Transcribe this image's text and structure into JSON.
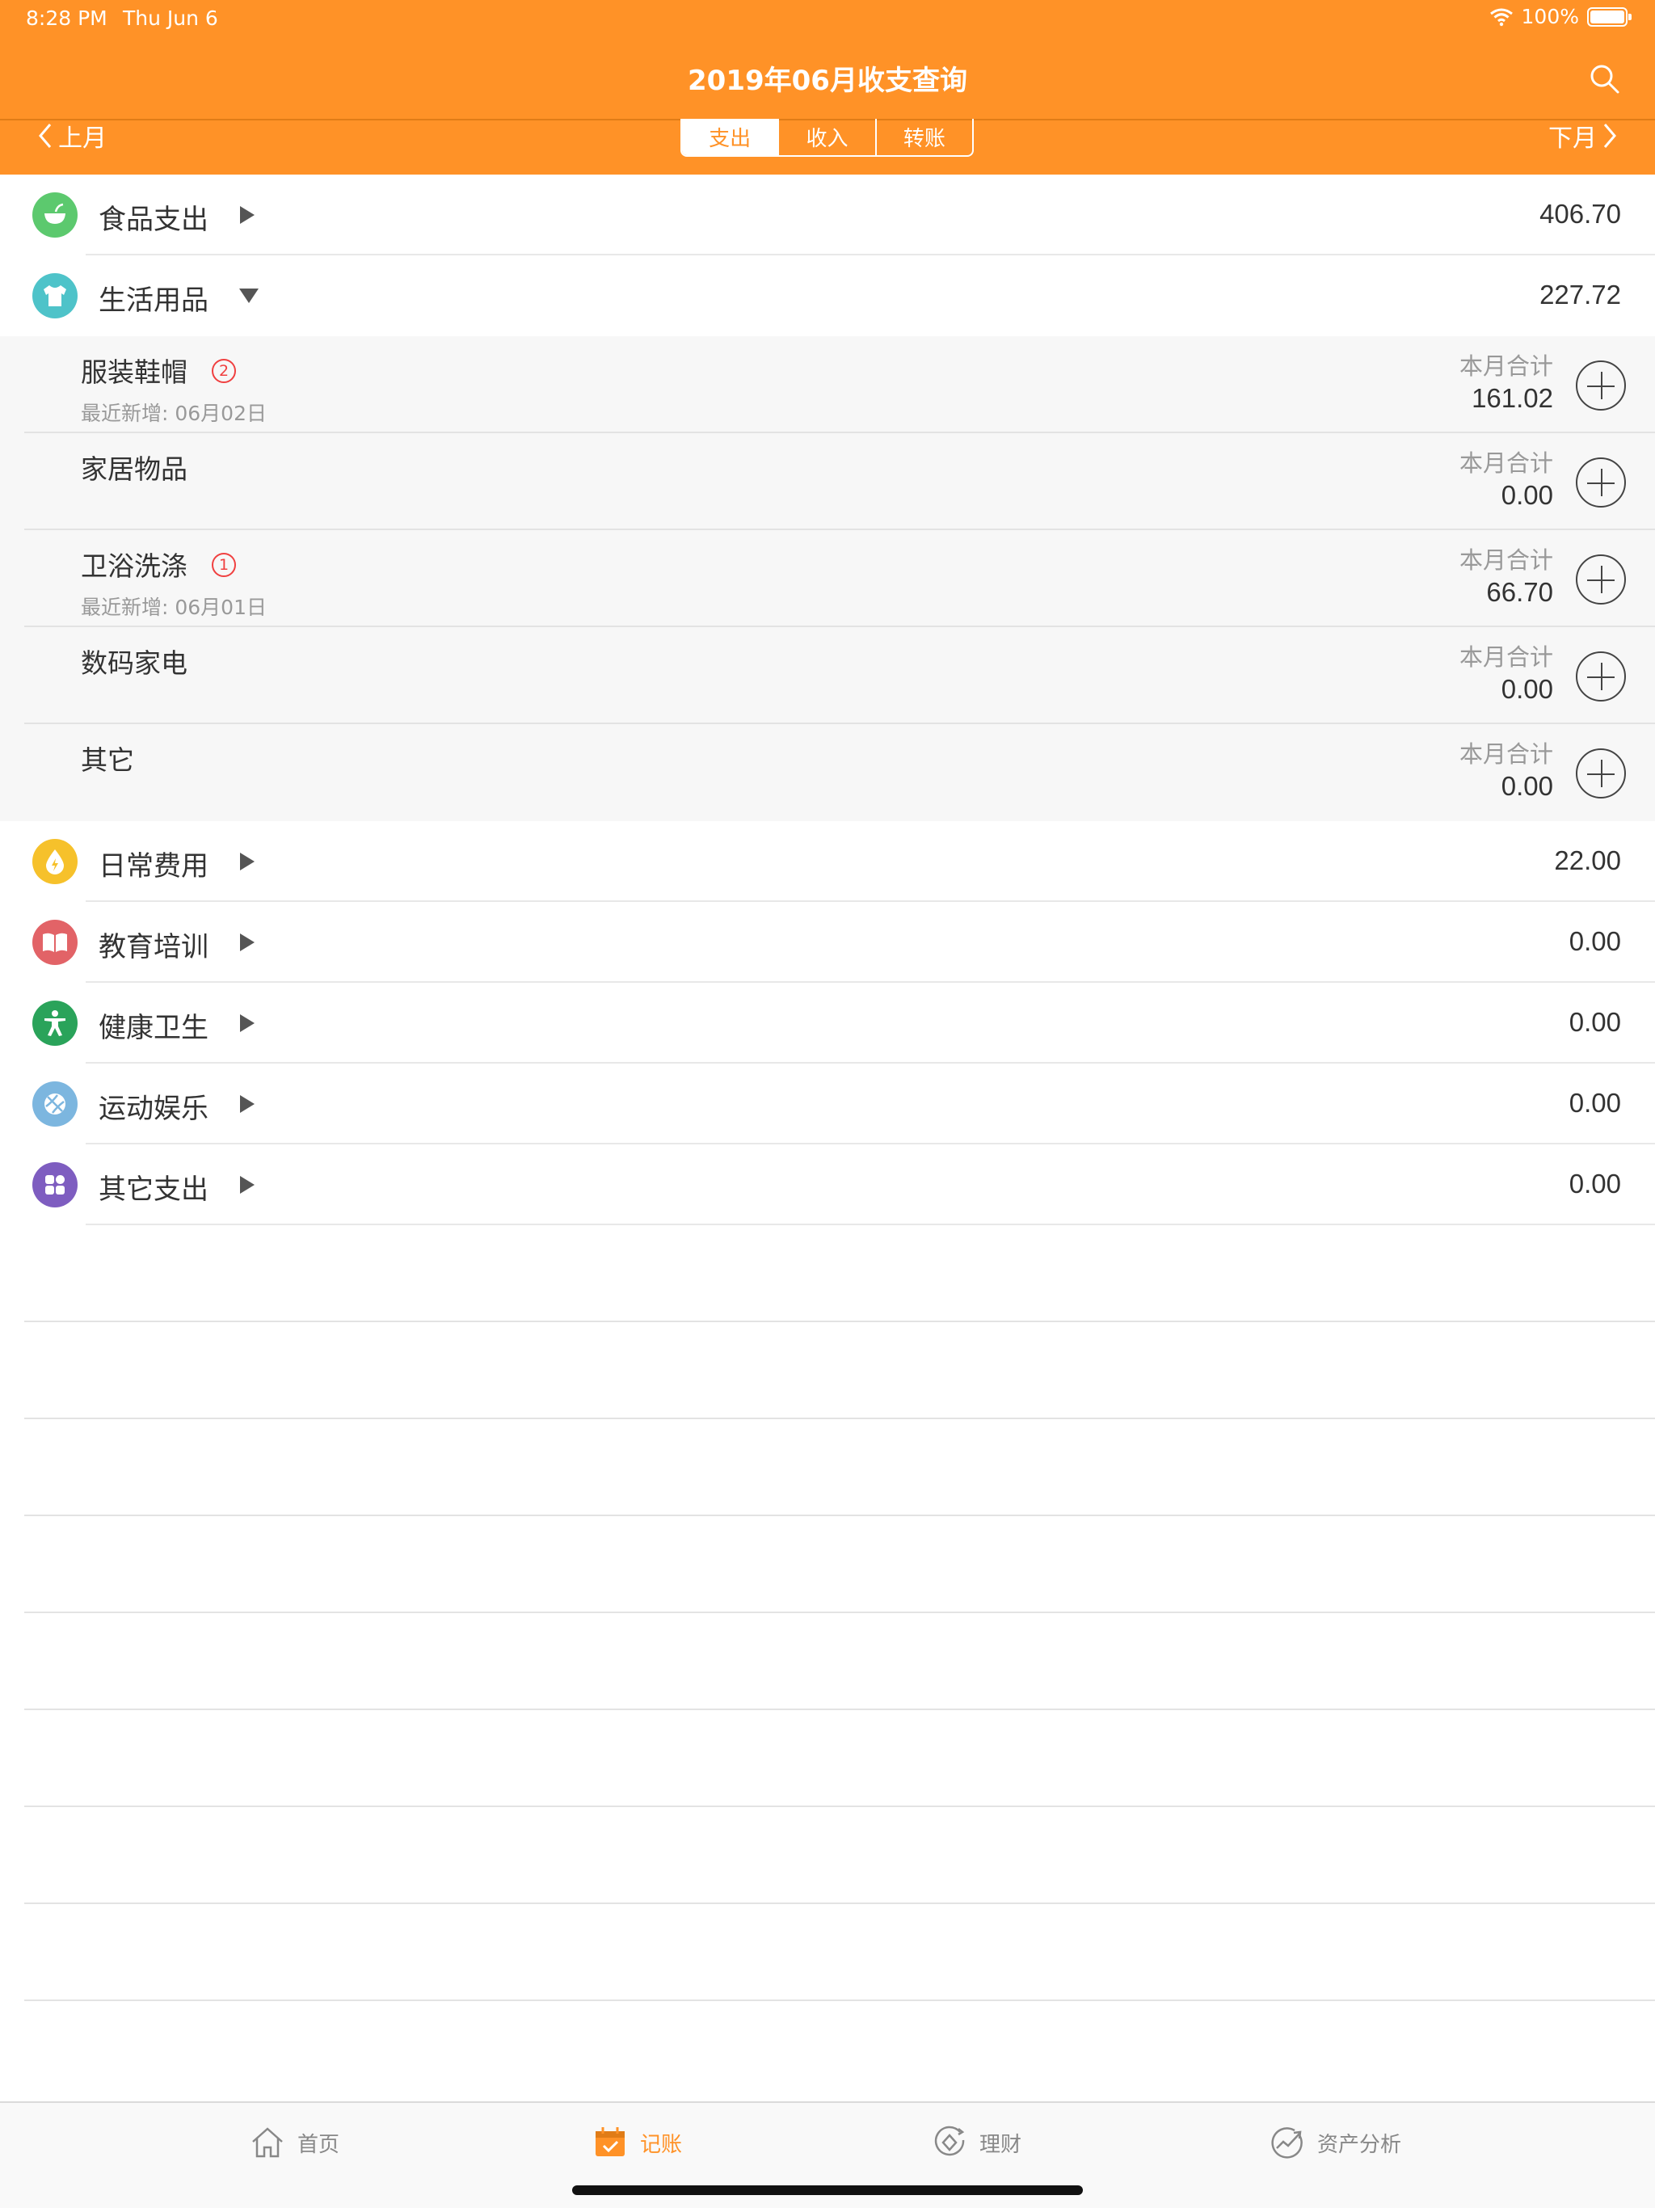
{
  "status_bar": {
    "time": "8:28 PM",
    "date": "Thu Jun 6",
    "battery": "100%"
  },
  "header": {
    "title": "2019年06月收支查询",
    "prev": "上月",
    "next": "下月"
  },
  "segments": [
    {
      "label": "支出",
      "active": true
    },
    {
      "label": "收入",
      "active": false
    },
    {
      "label": "转账",
      "active": false
    }
  ],
  "categories": [
    {
      "name": "食品支出",
      "amount": "406.70",
      "icon": "bowl-icon",
      "color": "#5CC96E",
      "expanded": false
    },
    {
      "name": "生活用品",
      "amount": "227.72",
      "icon": "shirt-icon",
      "color": "#4EC3C9",
      "expanded": true
    },
    {
      "name": "日常费用",
      "amount": "22.00",
      "icon": "water-drop-icon",
      "color": "#F6C12B",
      "expanded": false
    },
    {
      "name": "教育培训",
      "amount": "0.00",
      "icon": "book-icon",
      "color": "#E26367",
      "expanded": false
    },
    {
      "name": "健康卫生",
      "amount": "0.00",
      "icon": "accessibility-icon",
      "color": "#2AA35A",
      "expanded": false
    },
    {
      "name": "运动娱乐",
      "amount": "0.00",
      "icon": "ball-icon",
      "color": "#7CB6DF",
      "expanded": false
    },
    {
      "name": "其它支出",
      "amount": "0.00",
      "icon": "grid-icon",
      "color": "#7E5DC0",
      "expanded": false
    }
  ],
  "subcategories": [
    {
      "name": "服装鞋帽",
      "badge": "2",
      "recent": "最近新增: 06月02日",
      "total_label": "本月合计",
      "total": "161.02"
    },
    {
      "name": "家居物品",
      "badge": "",
      "recent": "",
      "total_label": "本月合计",
      "total": "0.00"
    },
    {
      "name": "卫浴洗涤",
      "badge": "1",
      "recent": "最近新增: 06月01日",
      "total_label": "本月合计",
      "total": "66.70"
    },
    {
      "name": "数码家电",
      "badge": "",
      "recent": "",
      "total_label": "本月合计",
      "total": "0.00"
    },
    {
      "name": "其它",
      "badge": "",
      "recent": "",
      "total_label": "本月合计",
      "total": "0.00"
    }
  ],
  "tabbar": [
    {
      "label": "首页",
      "icon": "home-icon",
      "active": false
    },
    {
      "label": "记账",
      "icon": "calendar-check-icon",
      "active": true
    },
    {
      "label": "理财",
      "icon": "finance-icon",
      "active": false
    },
    {
      "label": "资产分析",
      "icon": "trend-chart-icon",
      "active": false
    }
  ],
  "colors": {
    "accent": "#FF9227",
    "badge": "#F04040"
  }
}
